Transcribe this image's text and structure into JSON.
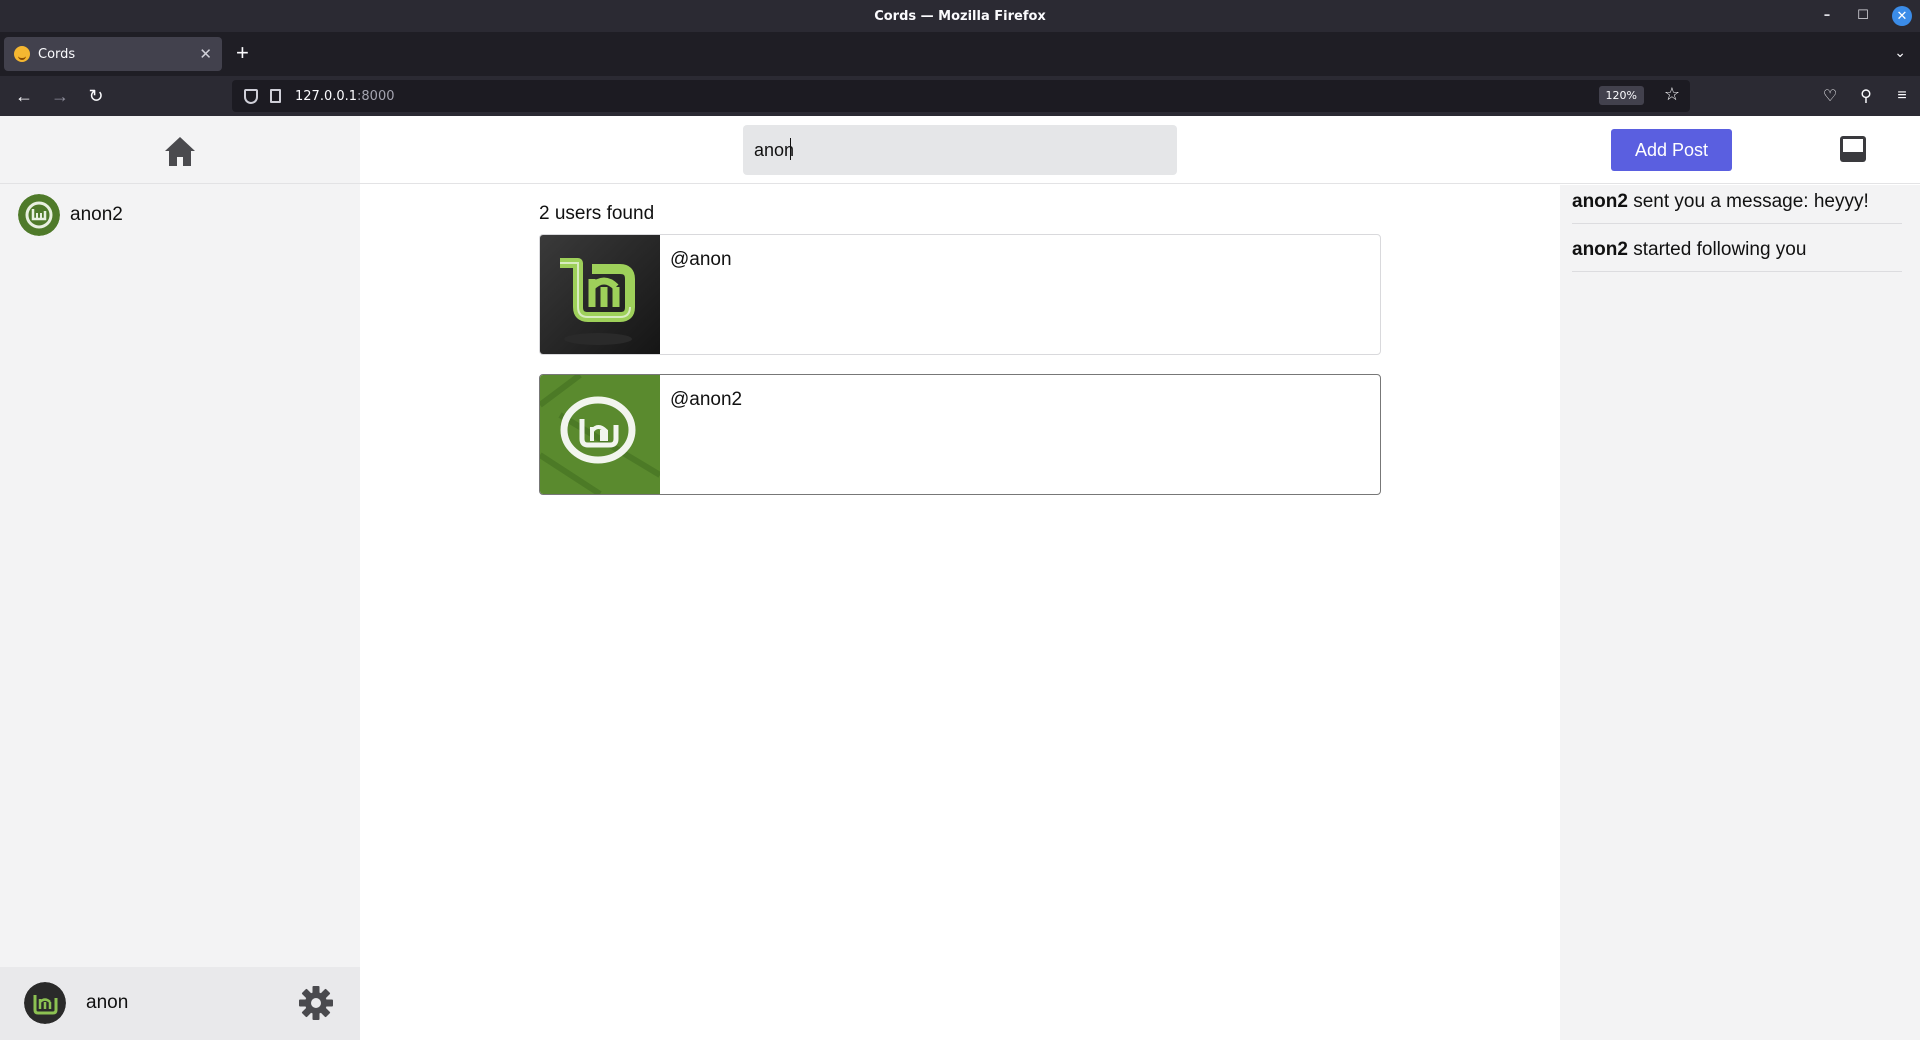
{
  "browser": {
    "window_title": "Cords — Mozilla Firefox",
    "tab_title": "Cords",
    "url_host": "127.0.0.1",
    "url_port": ":8000",
    "zoom": "120%"
  },
  "sidebar": {
    "contacts": [
      {
        "name": "anon2"
      }
    ],
    "current_user": {
      "name": "anon"
    }
  },
  "header": {
    "search": {
      "value": "anon"
    },
    "add_post_label": "Add Post"
  },
  "main": {
    "results_count_text": "2 users found",
    "results": [
      {
        "handle": "@anon"
      },
      {
        "handle": "@anon2"
      }
    ]
  },
  "notifications": [
    {
      "user": "anon2",
      "text": " sent you a message: heyyy!"
    },
    {
      "user": "anon2",
      "text": " started following you"
    }
  ],
  "colors": {
    "accent": "#5a5fe0",
    "sidebar_bg": "#f3f3f4",
    "avatar_green": "#4f7a2a",
    "avatar_dark": "#2a2a2a"
  }
}
